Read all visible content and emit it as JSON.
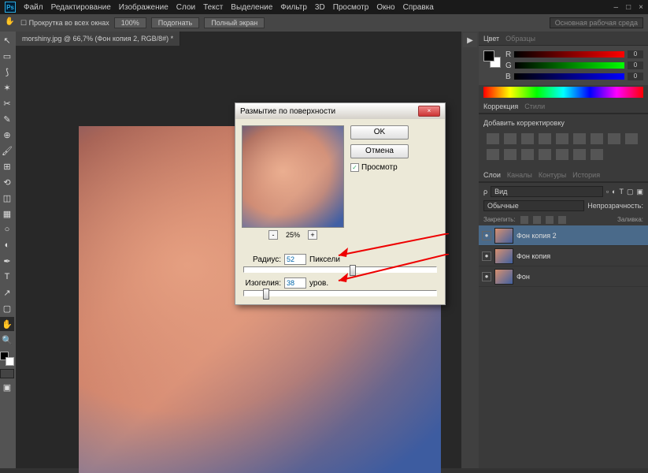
{
  "app": {
    "logo": "Ps"
  },
  "menu": [
    "Файл",
    "Редактирование",
    "Изображение",
    "Слои",
    "Текст",
    "Выделение",
    "Фильтр",
    "3D",
    "Просмотр",
    "Окно",
    "Справка"
  ],
  "options": {
    "scroll_all": "Прокрутка во всех окнах",
    "b1": "100%",
    "b2": "Подогнать",
    "b3": "Полный экран",
    "workspace": "Основная рабочая среда"
  },
  "doc_tab": "morshiny.jpg @ 66,7% (Фон копия 2, RGB/8#) *",
  "color_panel": {
    "tab1": "Цвет",
    "tab2": "Образцы",
    "r": "0",
    "g": "0",
    "b": "0"
  },
  "adjustments": {
    "tab1": "Коррекция",
    "tab2": "Стили",
    "title": "Добавить корректировку"
  },
  "layers": {
    "tab1": "Слои",
    "tab2": "Каналы",
    "tab3": "Контуры",
    "tab4": "История",
    "kind": "Вид",
    "blend": "Обычные",
    "opacity_lbl": "Непрозрачность:",
    "lock_lbl": "Закрепить:",
    "fill_lbl": "Заливка:",
    "items": [
      {
        "name": "Фон копия 2"
      },
      {
        "name": "Фон копия"
      },
      {
        "name": "Фон"
      }
    ]
  },
  "dialog": {
    "title": "Размытие по поверхности",
    "ok": "OK",
    "cancel": "Отмена",
    "preview_lbl": "Просмотр",
    "zoom": "25%",
    "radius_lbl": "Радиус:",
    "radius_val": "52",
    "radius_unit": "Пиксели",
    "isohelia_lbl": "Изогелия:",
    "isohelia_val": "38",
    "isohelia_unit": "уров."
  }
}
